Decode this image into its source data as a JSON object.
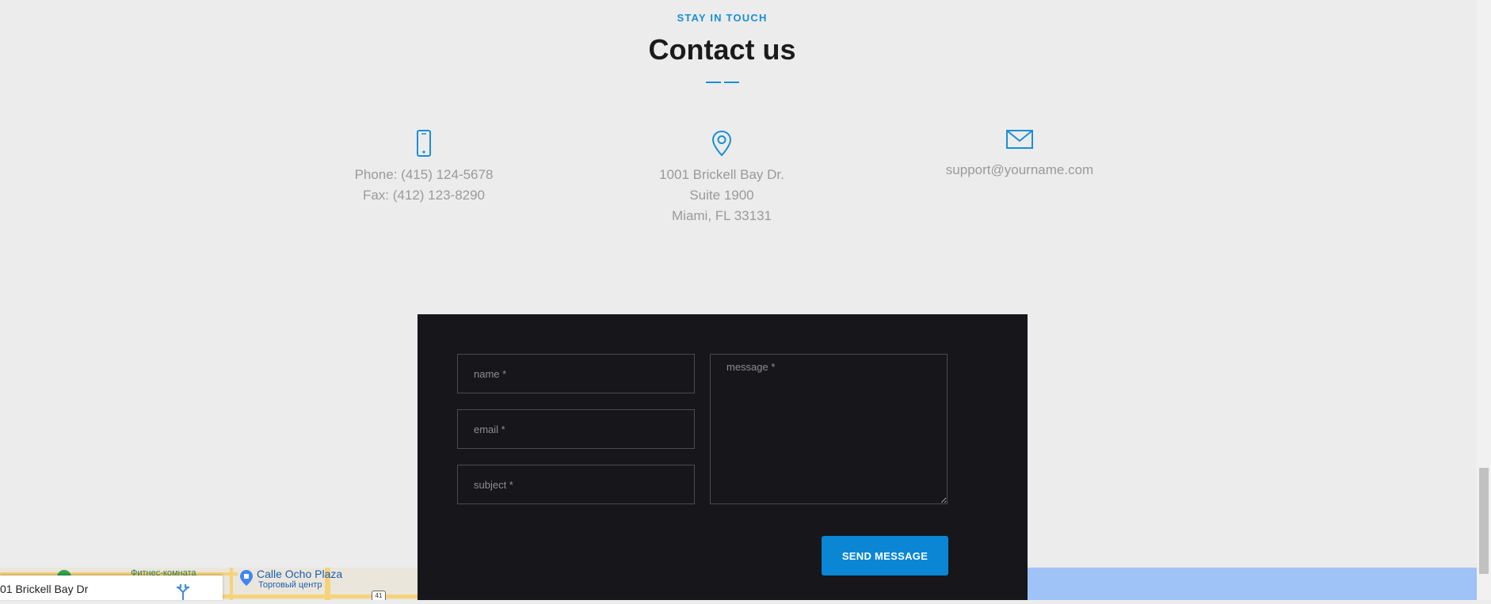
{
  "section": {
    "eyebrow": "STAY IN TOUCH",
    "title": "Contact us"
  },
  "contact": {
    "phone_lines": [
      "Phone: (415) 124-5678",
      "Fax: (412) 123-8290"
    ],
    "address_lines": [
      "1001 Brickell Bay Dr.",
      "Suite 1900",
      "Miami, FL 33131"
    ],
    "email": "support@yourname.com"
  },
  "form": {
    "name_placeholder": "name *",
    "email_placeholder": "email *",
    "subject_placeholder": "subject *",
    "message_placeholder": "message *",
    "send_label": "SEND MESSAGE"
  },
  "map": {
    "label_fitness": "Фитнес-комната",
    "label_plaza": "Calle Ocho Plaza",
    "label_plaza_sub": "Торговый центр",
    "route_shield": "41",
    "card_address": "01 Brickell Bay Dr"
  },
  "colors": {
    "accent": "#1a8fd6",
    "button": "#0a86d4",
    "panel": "#17171b",
    "background": "#ececec"
  }
}
